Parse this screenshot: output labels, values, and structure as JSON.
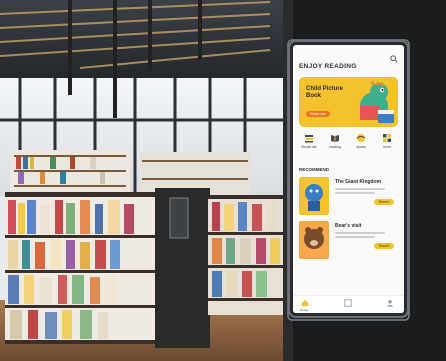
{
  "app": {
    "title": "ENJOY READING",
    "banner": {
      "title": "Child Picture Book",
      "button": "Read now"
    },
    "categories": [
      {
        "label": "Books list",
        "icon": "book-stack-icon"
      },
      {
        "label": "reading",
        "icon": "open-book-icon"
      },
      {
        "label": "sports",
        "icon": "ball-icon"
      },
      {
        "label": "more",
        "icon": "grid-icon"
      }
    ],
    "section_title": "RECOMMEND",
    "books": [
      {
        "title": "The Giant Kingdom",
        "button": "Read it"
      },
      {
        "title": "Bear's visit",
        "button": "Read it"
      }
    ],
    "tab_home": "Home"
  },
  "colors": {
    "accent": "#f3c22c",
    "orange": "#e8781a",
    "kiosk_frame": "#2a2b2e"
  }
}
